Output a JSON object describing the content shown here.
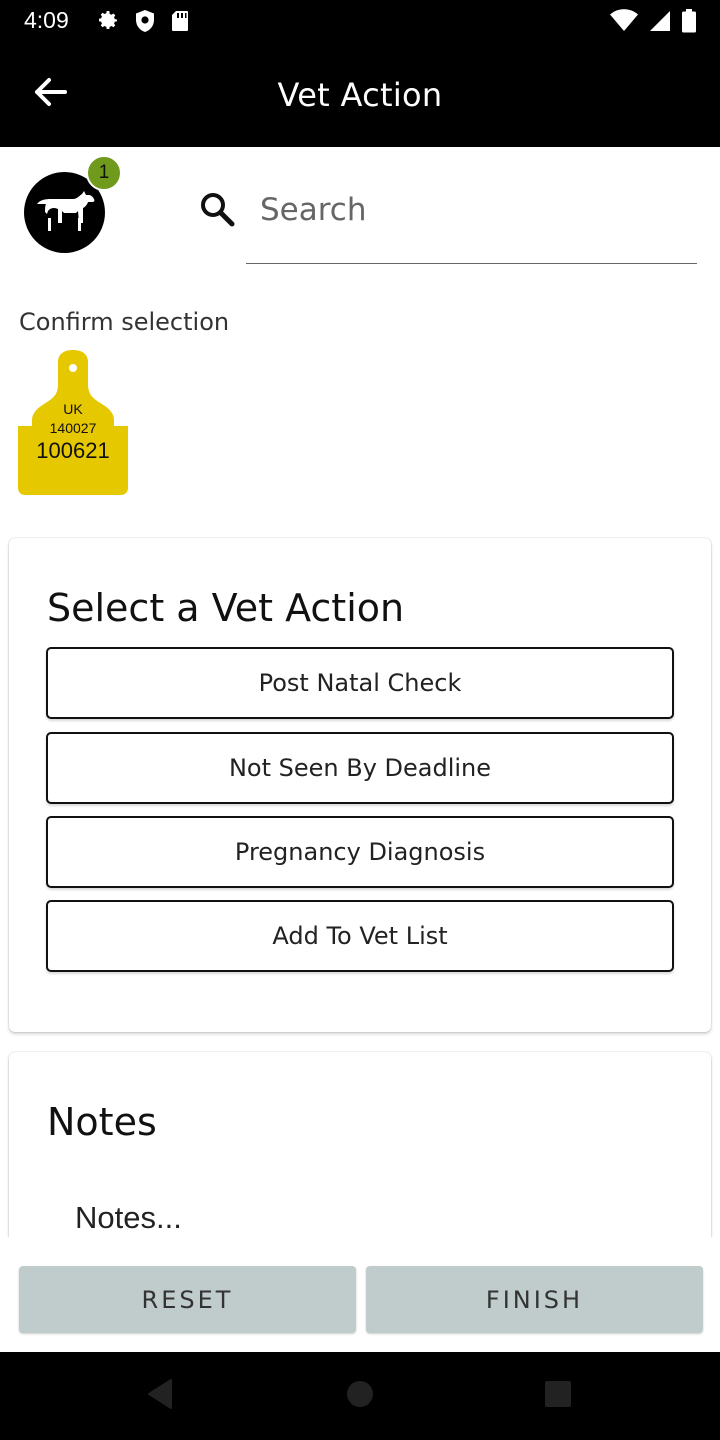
{
  "status_bar": {
    "time": "4:09",
    "left_icons": [
      "gear-icon",
      "shield-icon",
      "sd-card-icon"
    ],
    "right_icons": [
      "wifi-icon",
      "signal-icon",
      "battery-icon"
    ]
  },
  "app_bar": {
    "title": "Vet Action",
    "back_icon": "arrow-left-icon"
  },
  "selection": {
    "count": "1",
    "avatar_icon": "cow-icon",
    "confirm_label": "Confirm selection",
    "tag": {
      "country": "UK",
      "herd": "140027",
      "number": "100621",
      "color": "#e6c800"
    }
  },
  "search": {
    "placeholder": "Search",
    "value": ""
  },
  "vet_action": {
    "title": "Select a Vet Action",
    "options": [
      "Post Natal Check",
      "Not Seen By Deadline",
      "Pregnancy Diagnosis",
      "Add To Vet List"
    ]
  },
  "notes": {
    "title": "Notes",
    "placeholder": "Notes..."
  },
  "buttons": {
    "reset": "RESET",
    "finish": "FINISH"
  },
  "colors": {
    "bar": "#000000",
    "badge": "#6f9a1c",
    "button_disabled": "#c0cccc",
    "tag": "#e6c800"
  }
}
